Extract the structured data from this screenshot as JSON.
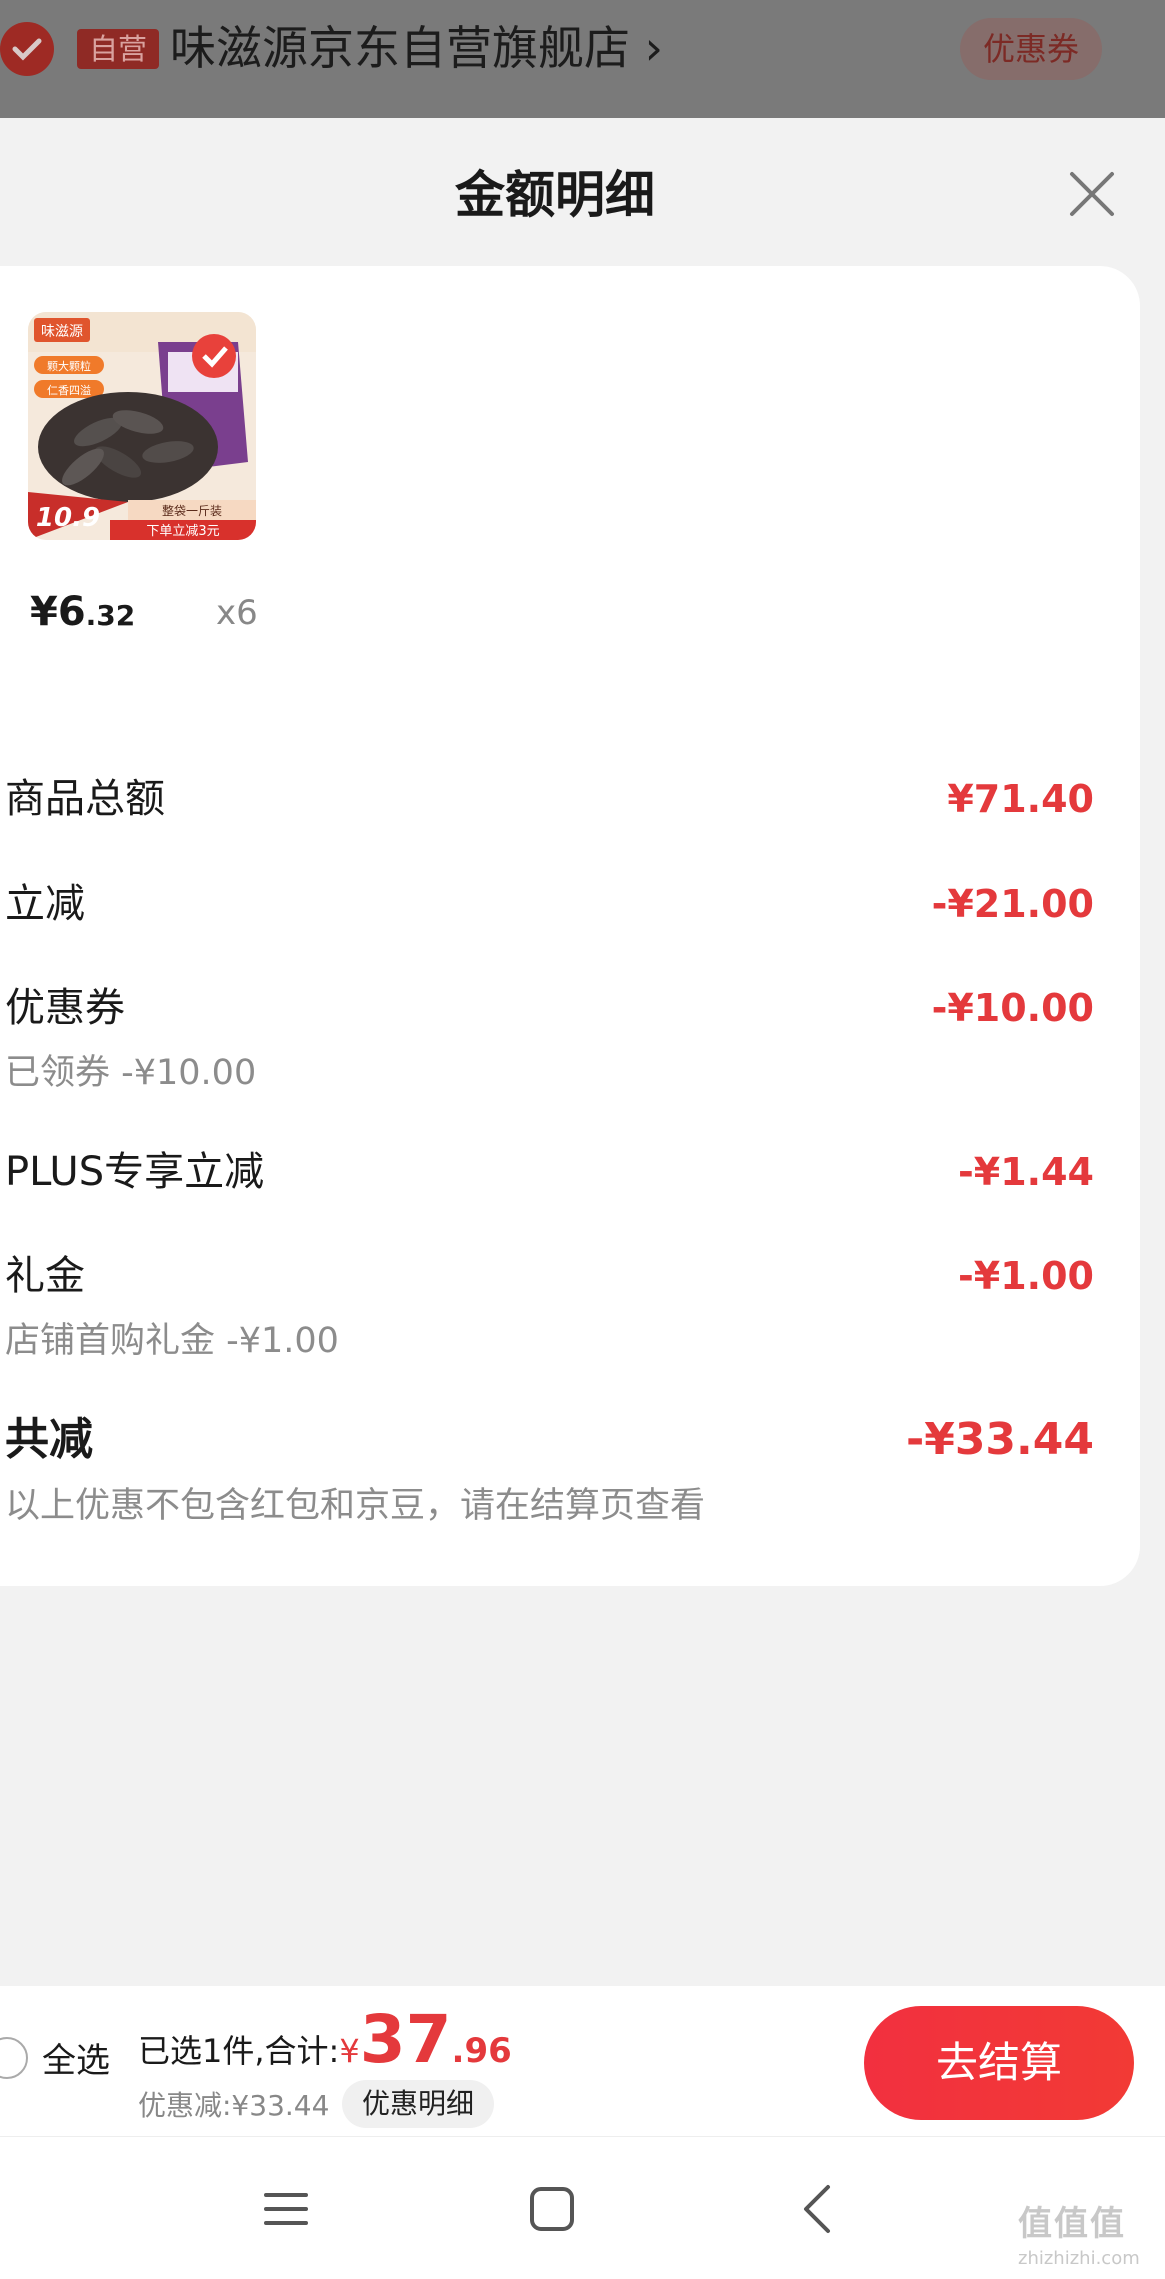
{
  "store": {
    "tag": "自营",
    "name": "味滋源京东自营旗舰店 ›",
    "coupon_label": "优惠券"
  },
  "sheet": {
    "title": "金额明细"
  },
  "product": {
    "price_integer": "¥6",
    "price_decimal": ".32",
    "quantity": "x6",
    "image_texts": {
      "brand": "味滋源",
      "badge_1": "颗大颗粒",
      "badge_2": "仁香四溢",
      "promo_price": "10.9",
      "promo_tag": "整袋一斤装",
      "promo_banner": "下单立减3元"
    }
  },
  "details": {
    "rows": [
      {
        "label": "商品总额",
        "value": "¥71.40"
      },
      {
        "label": "立减",
        "value": "-¥21.00"
      },
      {
        "label": "优惠券",
        "value": "-¥10.00",
        "sub": "已领券 -¥10.00"
      },
      {
        "label": "PLUS专享立减",
        "value": "-¥1.44"
      },
      {
        "label": "礼金",
        "value": "-¥1.00",
        "sub": "店铺首购礼金 -¥1.00"
      }
    ],
    "total": {
      "label": "共减",
      "value": "-¥33.44",
      "note": "以上优惠不包含红包和京豆，请在结算页查看"
    }
  },
  "bottom_bar": {
    "select_all": "全选",
    "selected_text": "已选1件,合计:",
    "total_yen": "¥",
    "total_int": "37",
    "total_dec": ".96",
    "discount_text": "优惠减:¥33.44",
    "detail_button": "优惠明细",
    "checkout_button": "去结算"
  },
  "watermark": {
    "text": "值值值",
    "url": "zhizhizhi.com"
  },
  "colors": {
    "accent_red": "#e4393c",
    "checkout_gradient_start": "#f2303f",
    "sheet_bg": "#f2f2f2"
  }
}
